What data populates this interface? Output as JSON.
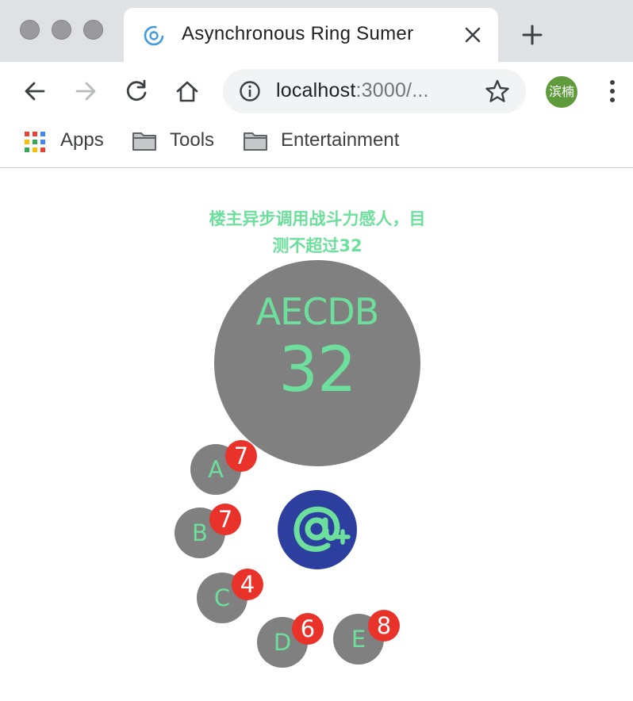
{
  "browser": {
    "tab": {
      "title": "Asynchronous Ring Sumer",
      "favicon": "react-logo-icon"
    },
    "url": {
      "host": "localhost",
      "rest": ":3000/..."
    },
    "profile_initials": "滨楠",
    "bookmarks": [
      {
        "label": "Apps",
        "icon": "apps-grid-icon"
      },
      {
        "label": "Tools",
        "icon": "folder-icon"
      },
      {
        "label": "Entertainment",
        "icon": "folder-icon"
      }
    ]
  },
  "app": {
    "message": "楼主异步调用战斗力感人，目测不超过32",
    "result": {
      "order": "AECDB",
      "sum": "32"
    },
    "sum_button": {
      "icon": "at-plus-icon"
    },
    "buttons": [
      {
        "label": "A",
        "value": "7"
      },
      {
        "label": "B",
        "value": "7"
      },
      {
        "label": "C",
        "value": "4"
      },
      {
        "label": "D",
        "value": "6"
      },
      {
        "label": "E",
        "value": "8"
      }
    ]
  },
  "colors": {
    "accent_green": "#6ddf9c",
    "circle_gray": "#808080",
    "badge_red": "#e8322a",
    "button_blue": "#2c3e9e"
  }
}
